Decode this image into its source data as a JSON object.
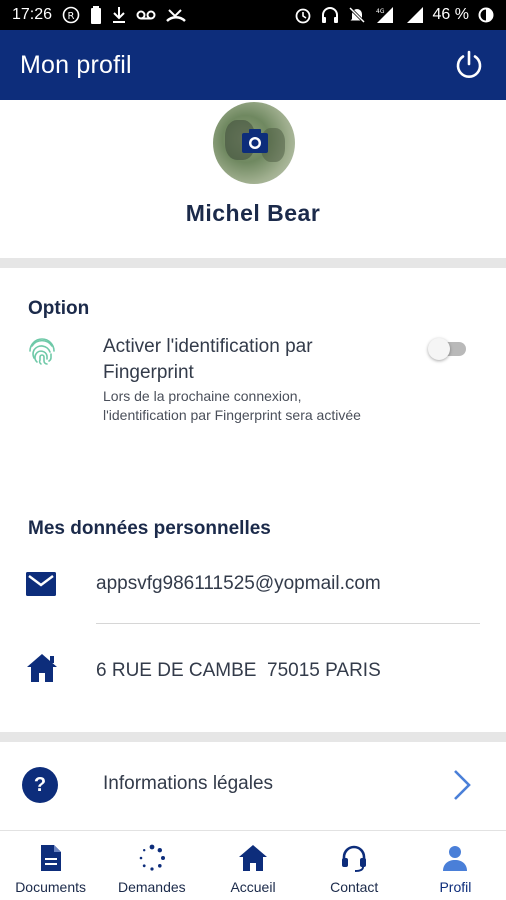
{
  "status_bar": {
    "time": "17:26",
    "battery": "46 %",
    "network": "4G"
  },
  "app_bar": {
    "title": "Mon profil"
  },
  "profile": {
    "name": "Michel Bear"
  },
  "option": {
    "title": "Option",
    "fingerprint_label": "Activer l'identification par Fingerprint",
    "fingerprint_sub": "Lors de la prochaine connexion, l'identification par Fingerprint sera activée",
    "fingerprint_enabled": false
  },
  "personal": {
    "title": "Mes données personnelles",
    "email": "appsvfg986111525@yopmail.com",
    "address": "6 RUE DE CAMBE  75015 PARIS"
  },
  "legal": {
    "label": "Informations légales",
    "icon_text": "?"
  },
  "nav": {
    "items": [
      {
        "label": "Documents",
        "icon": "document-icon"
      },
      {
        "label": "Demandes",
        "icon": "spinner-icon"
      },
      {
        "label": "Accueil",
        "icon": "home-icon"
      },
      {
        "label": "Contact",
        "icon": "headset-icon"
      },
      {
        "label": "Profil",
        "icon": "user-icon",
        "active": true
      }
    ]
  },
  "colors": {
    "primary": "#0d2d7b",
    "accent_light": "#4a7fd8",
    "fingerprint": "#6fc9a8"
  }
}
